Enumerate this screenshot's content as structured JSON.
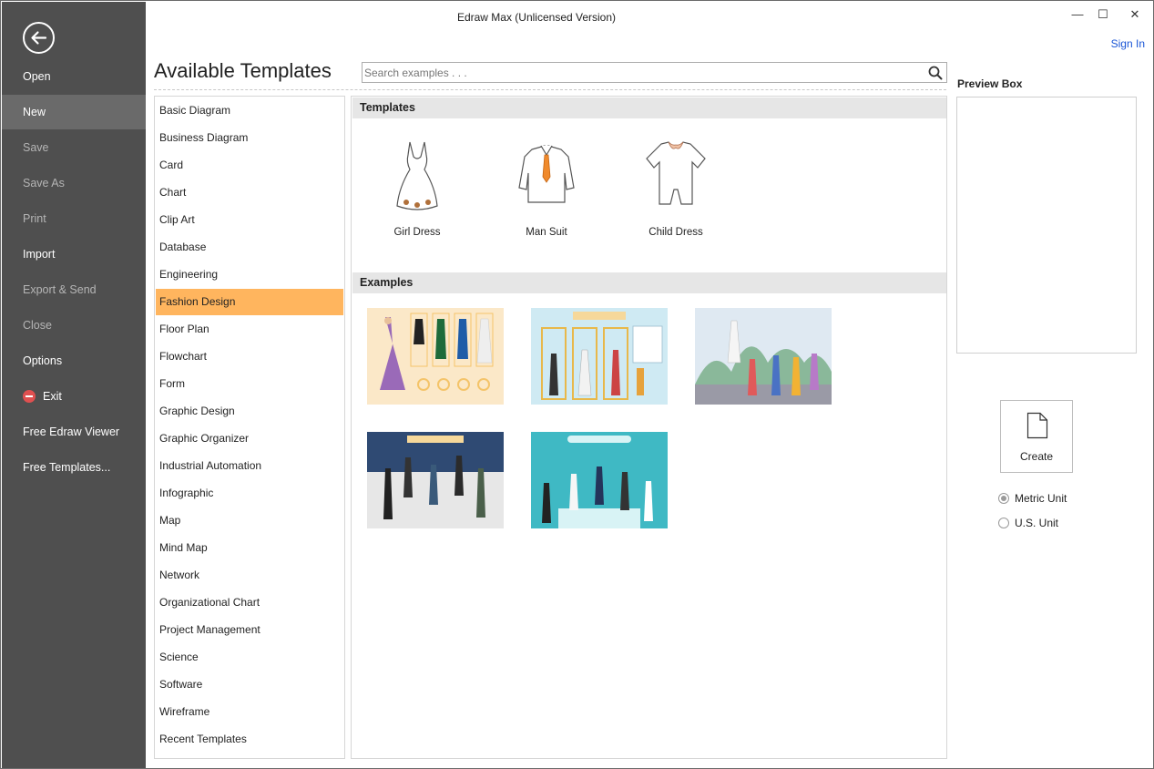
{
  "window": {
    "title": "Edraw Max (Unlicensed Version)",
    "sign_in": "Sign In",
    "controls": {
      "minimize": "—",
      "maximize": "☐",
      "close": "✕"
    }
  },
  "sidebar": {
    "items": [
      {
        "label": "Open",
        "state": "enabled"
      },
      {
        "label": "New",
        "state": "active"
      },
      {
        "label": "Save",
        "state": "disabled"
      },
      {
        "label": "Save As",
        "state": "disabled"
      },
      {
        "label": "Print",
        "state": "disabled"
      },
      {
        "label": "Import",
        "state": "enabled"
      },
      {
        "label": "Export & Send",
        "state": "disabled"
      },
      {
        "label": "Close",
        "state": "disabled"
      },
      {
        "label": "Options",
        "state": "enabled"
      },
      {
        "label": "Exit",
        "state": "enabled",
        "icon": "exit-icon"
      },
      {
        "label": "Free Edraw Viewer",
        "state": "enabled"
      },
      {
        "label": "Free Templates...",
        "state": "enabled"
      }
    ]
  },
  "main": {
    "heading": "Available Templates",
    "search_placeholder": "Search examples . . .",
    "categories": [
      "Basic Diagram",
      "Business Diagram",
      "Card",
      "Chart",
      "Clip Art",
      "Database",
      "Engineering",
      "Fashion Design",
      "Floor Plan",
      "Flowchart",
      "Form",
      "Graphic Design",
      "Graphic Organizer",
      "Industrial Automation",
      "Infographic",
      "Map",
      "Mind Map",
      "Network",
      "Organizational Chart",
      "Project Management",
      "Science",
      "Software",
      "Wireframe",
      "Recent Templates"
    ],
    "selected_category": "Fashion Design",
    "templates_header": "Templates",
    "templates": [
      {
        "label": "Girl Dress",
        "icon": "girl-dress-icon"
      },
      {
        "label": "Man Suit",
        "icon": "man-suit-icon"
      },
      {
        "label": "Child Dress",
        "icon": "child-dress-icon"
      }
    ],
    "examples_header": "Examples",
    "examples": [
      {
        "name": "gown-collection-example",
        "colors": [
          "#fbe8c8",
          "#f4c46a"
        ]
      },
      {
        "name": "fashion-boutique-example",
        "colors": [
          "#cfeaf3",
          "#f6d89a"
        ]
      },
      {
        "name": "street-fashion-example",
        "colors": [
          "#dfe9f2",
          "#8ab89a"
        ]
      },
      {
        "name": "mens-fashion-show-example",
        "colors": [
          "#2f4a73",
          "#e7e7e7"
        ]
      },
      {
        "name": "children-fashion-example",
        "colors": [
          "#3fb9c4",
          "#d8f3f5"
        ]
      }
    ]
  },
  "right_panel": {
    "preview_label": "Preview Box",
    "create_label": "Create",
    "units": [
      {
        "label": "Metric Unit",
        "checked": true
      },
      {
        "label": "U.S. Unit",
        "checked": false
      }
    ]
  },
  "colors": {
    "sidebar": "#4f4f4f",
    "selected_category": "#ffb55e",
    "link": "#1a56d6"
  }
}
